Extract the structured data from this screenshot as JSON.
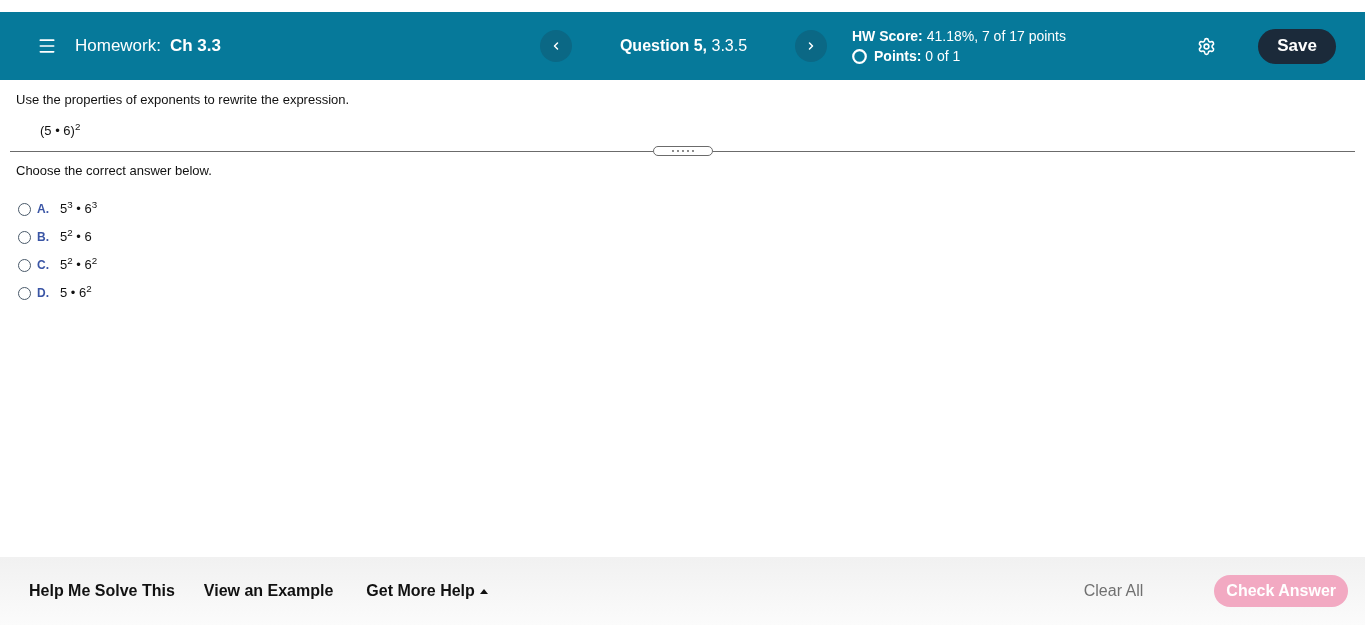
{
  "header": {
    "title_prefix": "Homework:",
    "title": "Ch 3.3",
    "question": "**Question 5,** 3.3.5",
    "score": "**HW Score:** 41.18%, 7 of 17 points",
    "points": "**Points:** 0 of 1",
    "save_button": "Save"
  },
  "question": {
    "instruction": "Use the properties of exponents to rewrite the expression.",
    "expression": "(5 • 6)$^{2}$"
  },
  "answer": {
    "prompt": "Choose the correct answer below.",
    "options": [
      {
        "letter": "A.",
        "text": "5$^{3}$ • 6$^{3}$",
        "selected": false
      },
      {
        "letter": "B.",
        "text": "5$^{2}$ • 6",
        "selected": false
      },
      {
        "letter": "C.",
        "text": "5$^{2}$ • 6$^{2}$",
        "selected": false
      },
      {
        "letter": "D.",
        "text": "5 • 6$^{2}$",
        "selected": false
      }
    ]
  },
  "footer": {
    "links": [
      "Help Me Solve This",
      "View an Example"
    ],
    "more_help": "Get More Help",
    "clear_button": "Clear All",
    "check_button": {
      "label": "Check Answer",
      "disabled": true
    }
  }
}
